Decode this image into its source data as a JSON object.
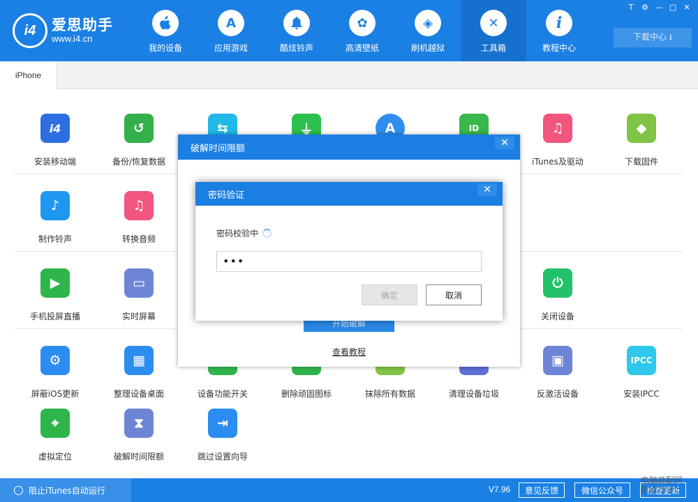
{
  "app": {
    "name": "爱思助手",
    "url": "www.i4.cn",
    "logo_text": "i4"
  },
  "nav": [
    {
      "label": "我的设备",
      "icon": "apple-icon",
      "glyph": ""
    },
    {
      "label": "应用游戏",
      "icon": "app-store-icon",
      "glyph": "A"
    },
    {
      "label": "酷炫铃声",
      "icon": "bell-icon",
      "glyph": "♫"
    },
    {
      "label": "高清壁纸",
      "icon": "flower-icon",
      "glyph": "✿"
    },
    {
      "label": "刷机越狱",
      "icon": "dropbox-icon",
      "glyph": "◈"
    },
    {
      "label": "工具箱",
      "icon": "tools-icon",
      "glyph": "✕"
    },
    {
      "label": "教程中心",
      "icon": "info-icon",
      "glyph": "i"
    }
  ],
  "window_controls": [
    "T",
    "⚙",
    "—",
    "□",
    "✕"
  ],
  "download_center": "下载中心 ⭳",
  "tab": "iPhone",
  "tools": {
    "row1": [
      {
        "label": "安装移动端",
        "icon": "i4-mobile-icon",
        "glyph": "i4",
        "color": "#2d6fe0"
      },
      {
        "label": "备份/恢复数据",
        "icon": "backup-clock-icon",
        "glyph": "↺",
        "color": "#34b04a"
      },
      {
        "label": "",
        "icon": "transfer-icon",
        "glyph": "⇆",
        "color": "#20b9e8"
      },
      {
        "label": "",
        "icon": "usb-icon",
        "glyph": "⏚",
        "color": "#2cc04f"
      },
      {
        "label": "",
        "icon": "app-store-tool-icon",
        "glyph": "A",
        "color": "#2f8ef0"
      },
      {
        "label": "",
        "icon": "apple-id-icon",
        "glyph": "ID",
        "color": "#39b74a"
      },
      {
        "label": "iTunes及驱动",
        "icon": "itunes-icon",
        "glyph": "♫",
        "color": "#f2557e"
      },
      {
        "label": "下载固件",
        "icon": "cube-icon",
        "glyph": "◆",
        "color": "#7fc444"
      }
    ],
    "row2": [
      {
        "label": "制作铃声",
        "icon": "bell-plus-icon",
        "glyph": "♪",
        "color": "#1e97f0"
      },
      {
        "label": "转换音频",
        "icon": "music-note-icon",
        "glyph": "♫",
        "color": "#f2567f"
      }
    ],
    "row3": [
      {
        "label": "手机投屏直播",
        "icon": "phone-play-icon",
        "glyph": "▶",
        "color": "#2eb54c"
      },
      {
        "label": "实时屏幕",
        "icon": "monitor-icon",
        "glyph": "▭",
        "color": "#6e85d6"
      },
      {
        "label": "关闭设备",
        "icon": "power-icon",
        "glyph": "⏻",
        "color": "#23c26a"
      }
    ],
    "row4": [
      {
        "label": "屏蔽iOS更新",
        "icon": "gear-block-icon",
        "glyph": "⚙",
        "color": "#2c8df0"
      },
      {
        "label": "整理设备桌面",
        "icon": "grid-icon",
        "glyph": "▦",
        "color": "#2c8df0"
      },
      {
        "label": "设备功能开关",
        "icon": "toggle-icon",
        "glyph": "",
        "color": "#2eb54c"
      },
      {
        "label": "删除顽固图标",
        "icon": "delete-icon",
        "glyph": "",
        "color": "#2eb54c"
      },
      {
        "label": "抹除所有数据",
        "icon": "erase-icon",
        "glyph": "",
        "color": "#7fc444"
      },
      {
        "label": "清理设备垃圾",
        "icon": "clean-icon",
        "glyph": "",
        "color": "#5e6fd8"
      },
      {
        "label": "反激活设备",
        "icon": "deactivate-icon",
        "glyph": "▣",
        "color": "#6e85d6"
      },
      {
        "label": "安装IPCC",
        "icon": "ipcc-icon",
        "glyph": "IPCC",
        "color": "#2fc8ec"
      }
    ],
    "row5": [
      {
        "label": "虚拟定位",
        "icon": "location-pin-icon",
        "glyph": "⌖",
        "color": "#2eb54c"
      },
      {
        "label": "破解时间限额",
        "icon": "hourglass-icon",
        "glyph": "⧗",
        "color": "#6e85d6"
      },
      {
        "label": "跳过设置向导",
        "icon": "skip-wizard-icon",
        "glyph": "⇥",
        "color": "#2c8df0"
      }
    ]
  },
  "dialog_outer": {
    "title": "破解时间限额",
    "start_button": "开始破解",
    "tutorial_link": "查看教程"
  },
  "dialog_inner": {
    "title": "密码验证",
    "status": "密码校验中",
    "password_value": "•••",
    "ok_label": "确定",
    "cancel_label": "取消"
  },
  "footer": {
    "block_itunes": "阻止iTunes自动运行",
    "version": "V7.96",
    "feedback": "意见反馈",
    "wechat": "微信公众号",
    "check_update": "检查更新"
  },
  "watermark": {
    "line1": "电脑装配网",
    "line2": "dnpz.net"
  }
}
